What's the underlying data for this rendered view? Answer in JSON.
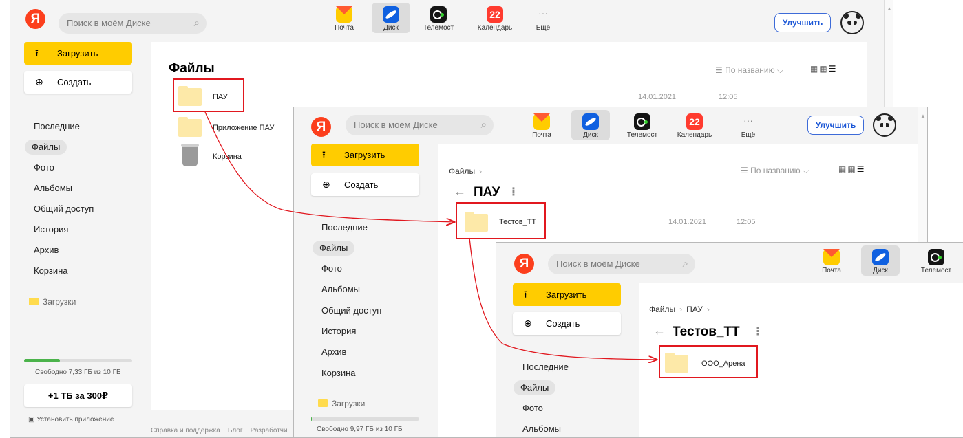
{
  "header": {
    "logo": "Я",
    "search_placeholder": "Поиск в моём Диске",
    "services": [
      "Почта",
      "Диск",
      "Телемост",
      "Календарь",
      "Ещё"
    ],
    "calendar_day": "22",
    "more_dots": "···",
    "upgrade": "Улучшить"
  },
  "sidebar": {
    "upload": "Загрузить",
    "create": "Создать",
    "nav": [
      "Последние",
      "Файлы",
      "Фото",
      "Альбомы",
      "Общий доступ",
      "История",
      "Архив",
      "Корзина"
    ],
    "downloads": "Загрузки",
    "storage1": "Свободно 7,33 ГБ из 10 ГБ",
    "storage1_fraction": 0.33,
    "storage2": "Свободно 9,97 ГБ из 10 ГБ",
    "storage2_fraction": 0.003,
    "buy": "+1 ТБ за 300₽",
    "install": "Установить приложение"
  },
  "footer": {
    "support": "Справка и поддержка",
    "blog": "Блог",
    "dev": "Разработчи"
  },
  "win1": {
    "title": "Файлы",
    "sort": "По названию",
    "items": [
      {
        "name": "ПАУ",
        "date": "14.01.2021",
        "time": "12:05"
      },
      {
        "name": "Приложение ПАУ"
      },
      {
        "name": "Корзина"
      }
    ]
  },
  "win2": {
    "crumb": "Файлы",
    "title": "ПАУ",
    "sort": "По названию",
    "item": {
      "name": "Тестов_ТТ",
      "date": "14.01.2021",
      "time": "12:05"
    }
  },
  "win3": {
    "crumb1": "Файлы",
    "crumb2": "ПАУ",
    "title": "Тестов_ТТ",
    "item": {
      "name": "ООО_Арена"
    }
  },
  "colors": {
    "accent_yellow": "#ffcc00",
    "highlight_red": "#e1181f",
    "brand_red": "#fc3f1d",
    "link_blue": "#1a56d6"
  }
}
